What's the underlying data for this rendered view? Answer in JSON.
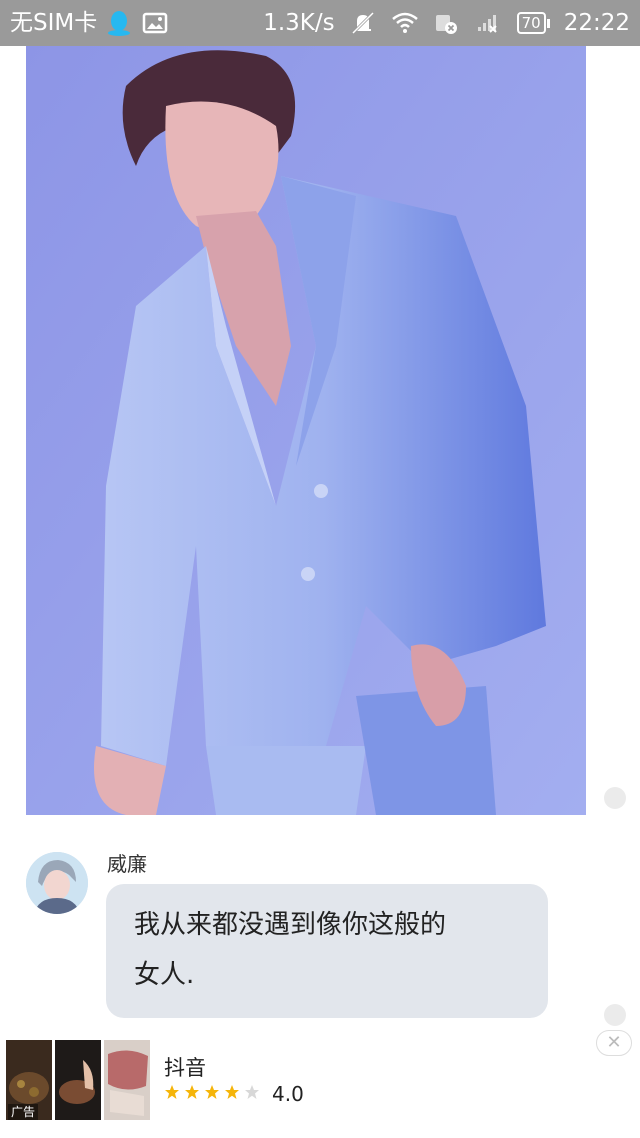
{
  "status_bar": {
    "carrier": "无SIM卡",
    "speed": "1.3K/s",
    "battery": "70",
    "time": "22:22",
    "icons": [
      "qq-icon",
      "image-icon",
      "mute-icon",
      "wifi-icon",
      "sync-icon",
      "signal-icon",
      "battery-icon"
    ]
  },
  "message": {
    "sender": "威廉",
    "lines": [
      "我从来都没遇到像你这般的",
      "女人."
    ]
  },
  "ad": {
    "app_name": "抖音",
    "rating": "4.0",
    "stars_filled": 4,
    "stars_total": 5,
    "label": "广告",
    "star_color": "#f5b50a"
  }
}
